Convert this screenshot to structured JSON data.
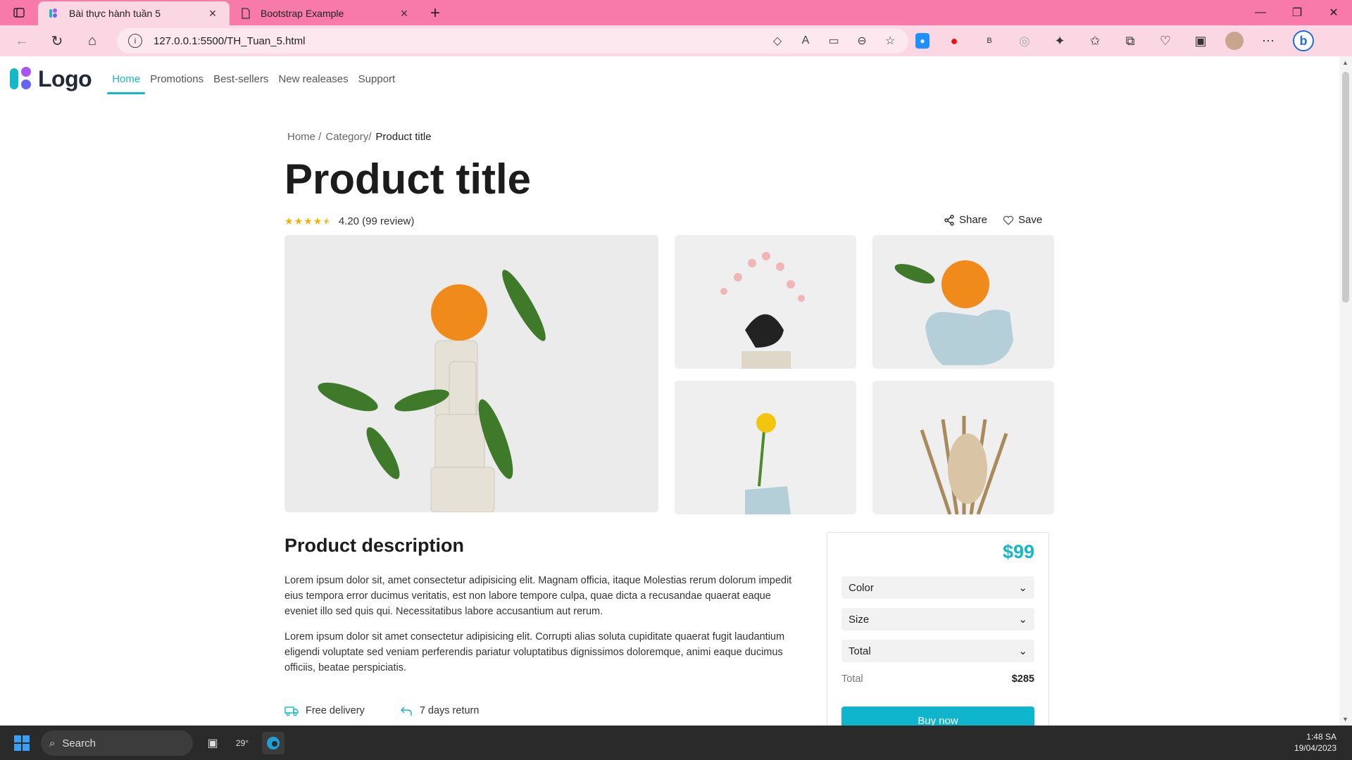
{
  "browser": {
    "tabs": [
      {
        "label": "Bài thực hành tuần 5",
        "active": true
      },
      {
        "label": "Bootstrap Example",
        "active": false
      }
    ],
    "url": "127.0.0.1:5500/TH_Tuan_5.html"
  },
  "site": {
    "logo_text": "Logo",
    "nav": [
      {
        "label": "Home",
        "active": true
      },
      {
        "label": "Promotions"
      },
      {
        "label": "Best-sellers"
      },
      {
        "label": "New realeases"
      },
      {
        "label": "Support"
      }
    ]
  },
  "breadcrumb": [
    "Home /",
    "Category/",
    "Product title"
  ],
  "product": {
    "title": "Product title",
    "rating_value": 4.2,
    "rating_text": "4.20 (99 review)",
    "share_label": "Share",
    "save_label": "Save"
  },
  "description": {
    "title": "Product description",
    "p1": "Lorem ipsum dolor sit, amet consectetur adipisicing elit. Magnam officia, itaque Molestias rerum dolorum impedit eius tempora error ducimus veritatis, est non labore tempore culpa, quae dicta a recusandae quaerat eaque eveniet illo sed quis qui. Necessitatibus labore accusantium aut rerum.",
    "p2": "Lorem ipsum dolor sit amet consectetur adipisicing elit. Corrupti alias soluta cupiditate quaerat fugit laudantium eligendi voluptate sed veniam perferendis pariatur voluptatibus dignissimos doloremque, animi eaque ducimus officiis, beatae perspiciatis.",
    "features": [
      "Free delivery",
      "7 days return"
    ]
  },
  "purchase": {
    "price": "$99",
    "selects": [
      "Color",
      "Size",
      "Total"
    ],
    "total_label": "Total",
    "total_value": "$285",
    "buy_label": "Buy now"
  },
  "taskbar": {
    "search_label": "Search",
    "weather": "29°",
    "time": "1:48 SA",
    "date": "19/04/2023"
  },
  "colors": {
    "accent": "#14b8c6",
    "titlebar": "#f87aa8",
    "toolbar": "#fbd6e3"
  }
}
